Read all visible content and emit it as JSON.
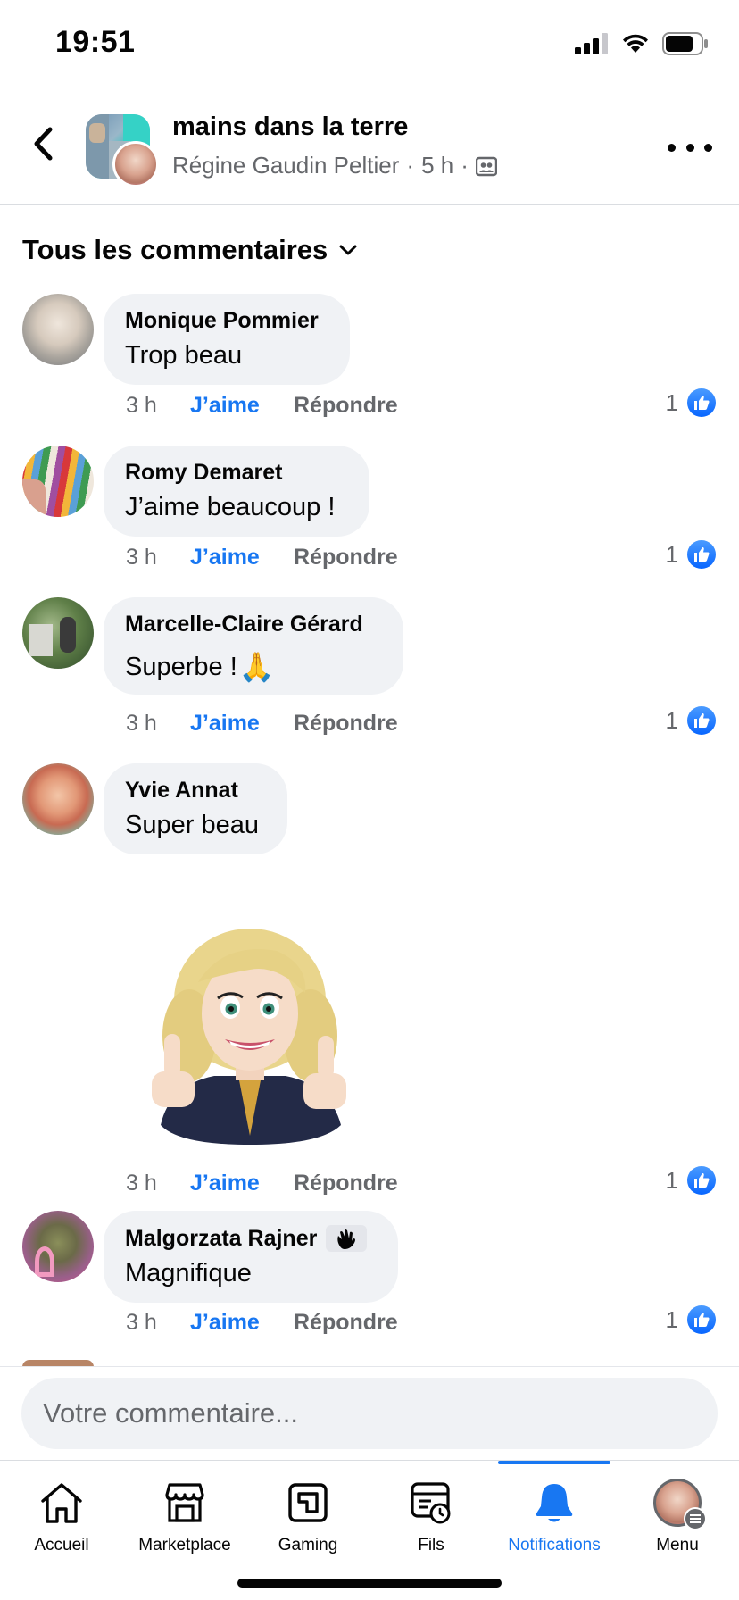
{
  "status_bar": {
    "time": "19:51"
  },
  "header": {
    "title": "mains dans la terre",
    "author": "Régine Gaudin Peltier",
    "separator": "·",
    "time": "5 h"
  },
  "filter": {
    "label": "Tous les commentaires"
  },
  "comments": [
    {
      "author": "Monique Pommier",
      "text": "Trop beau",
      "time": "3 h",
      "like_label": "J’aime",
      "reply_label": "Répondre",
      "likes": "1"
    },
    {
      "author": "Romy Demaret",
      "text": "J’aime beaucoup !",
      "time": "3 h",
      "like_label": "J’aime",
      "reply_label": "Répondre",
      "likes": "1"
    },
    {
      "author": "Marcelle-Claire Gérard",
      "text": "Superbe !",
      "emoji": "🙏",
      "time": "3 h",
      "like_label": "J’aime",
      "reply_label": "Répondre",
      "likes": "1"
    },
    {
      "author": "Yvie Annat",
      "text": "Super beau",
      "sticker": "avatar-thumbs-up-sticker",
      "time": "3 h",
      "like_label": "J’aime",
      "reply_label": "Répondre",
      "likes": "1"
    },
    {
      "author": "Malgorzata Rajner",
      "badge_icon": "waving-hand-icon",
      "text": "Magnifique",
      "time": "3 h",
      "like_label": "J’aime",
      "reply_label": "Répondre",
      "likes": "1"
    }
  ],
  "composer": {
    "placeholder": "Votre commentaire..."
  },
  "tabbar": {
    "tabs": [
      {
        "label": "Accueil",
        "icon": "home-icon"
      },
      {
        "label": "Marketplace",
        "icon": "marketplace-icon"
      },
      {
        "label": "Gaming",
        "icon": "gaming-icon"
      },
      {
        "label": "Fils",
        "icon": "feeds-icon"
      },
      {
        "label": "Notifications",
        "icon": "bell-icon",
        "active": true
      },
      {
        "label": "Menu",
        "icon": "profile-avatar"
      }
    ]
  },
  "colors": {
    "accent": "#1877f2",
    "bubble": "#f0f2f5",
    "secondary_text": "#65676b",
    "primary_text": "#050505"
  }
}
